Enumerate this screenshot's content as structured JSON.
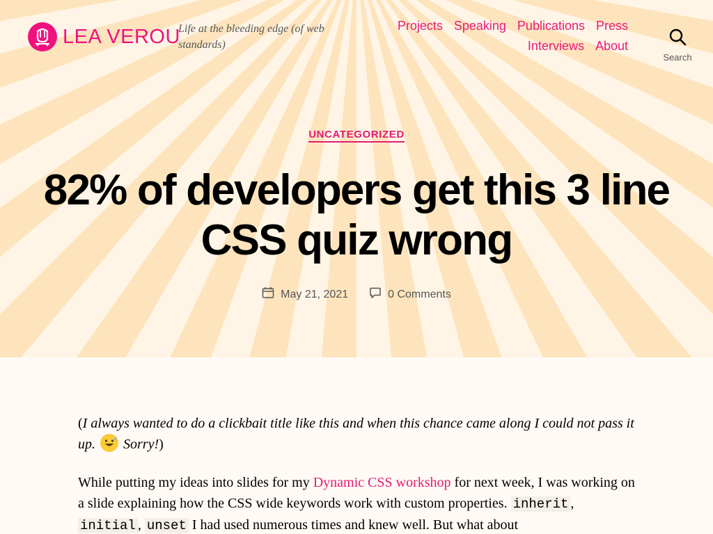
{
  "site": {
    "title": "LEA VEROU",
    "tagline": "Life at the bleeding edge (of web standards)"
  },
  "nav": {
    "items": [
      "Projects",
      "Speaking",
      "Publications",
      "Press",
      "Interviews",
      "About"
    ]
  },
  "search": {
    "label": "Search"
  },
  "post": {
    "category": "UNCATEGORIZED",
    "title": "82% of developers get this 3 line CSS quiz wrong",
    "date": "May 21, 2021",
    "comments": "0 Comments"
  },
  "content": {
    "intro_open": "(",
    "intro_text": "I always wanted to do a clickbait title like this and when this chance came along I could not pass it up.",
    "intro_sorry": "Sorry!",
    "intro_close": ")",
    "p2_a": "While putting my ideas into slides for my ",
    "p2_link": "Dynamic CSS workshop",
    "p2_b": " for next week, I was working on a slide explaining how the CSS wide keywords work with custom properties. ",
    "kw1": "inherit",
    "kw2": "initial",
    "kw3": "unset",
    "sep": ", ",
    "p2_c": " I had used numerous times and knew well. But what about"
  },
  "colors": {
    "accent": "#e21b74",
    "hero_light": "#fff5e6",
    "hero_dark": "#fde4bd"
  }
}
